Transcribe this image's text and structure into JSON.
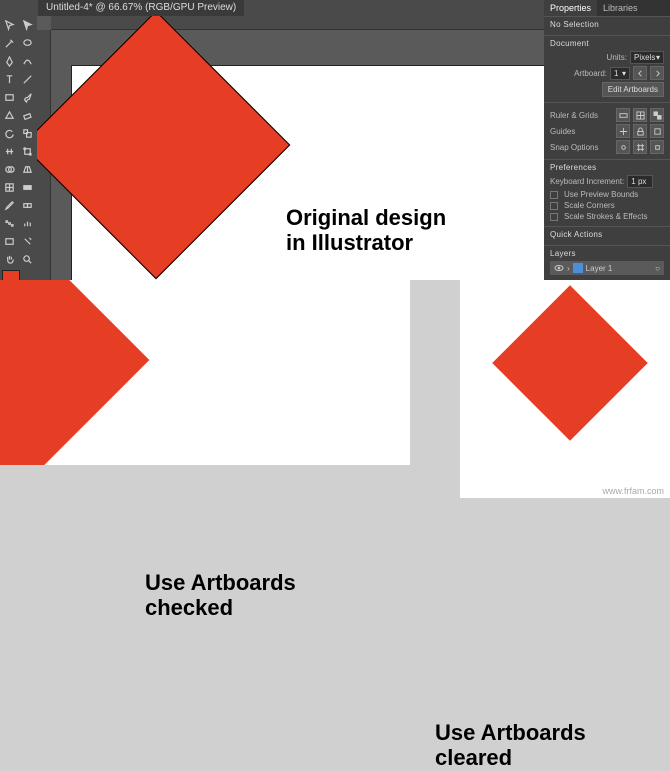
{
  "doc_tab": "Untitled-4* @ 66.67% (RGB/GPU Preview)",
  "caption_main_line1": "Original design",
  "caption_main_line2": "in Illustrator",
  "caption_left_line1": "Use Artboards",
  "caption_left_line2": "checked",
  "caption_right_line1": "Use Artboards",
  "caption_right_line2": "cleared",
  "properties": {
    "tab_properties": "Properties",
    "tab_libraries": "Libraries",
    "no_selection": "No Selection",
    "document_hd": "Document",
    "units_label": "Units:",
    "units_value": "Pixels",
    "artboard_label": "Artboard:",
    "artboard_value": "1",
    "edit_artboards": "Edit Artboards",
    "ruler_grids": "Ruler & Grids",
    "guides": "Guides",
    "snap_options": "Snap Options",
    "preferences": "Preferences",
    "keyboard_increment": "Keyboard Increment:",
    "keyboard_value": "1 px",
    "use_preview_bounds": "Use Preview Bounds",
    "scale_corners": "Scale Corners",
    "scale_strokes": "Scale Strokes & Effects",
    "quick_actions": "Quick Actions",
    "layers_hd": "Layers",
    "layer_name": "Layer 1"
  },
  "colors": {
    "shape": "#e63d25"
  },
  "watermark": "www.frfam.com"
}
